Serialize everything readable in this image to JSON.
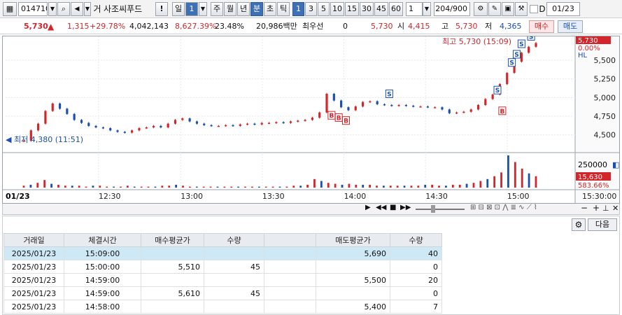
{
  "toolbar": {
    "code": "014710",
    "name": "사조씨푸드",
    "prefix": "거",
    "exclaim": "!",
    "period_day": "일",
    "period_num": "1",
    "periods": [
      "주",
      "월",
      "년",
      "분",
      "초",
      "틱"
    ],
    "periods_active": "분",
    "intervals": [
      "1",
      "3",
      "5",
      "10",
      "15",
      "30",
      "45",
      "60"
    ],
    "interval_active": "1",
    "interval_select": "1",
    "bar_count": "204/900",
    "check_label": "D",
    "date_value": "01/23"
  },
  "quote": {
    "price": "5,730",
    "change": "1,315",
    "change_pct": "+29.78%",
    "volume": "4,042,143",
    "vol_ratio": "8,627.39%",
    "turnover": "23.48%",
    "amount": "20,986백만",
    "best_label": "최우선",
    "best_value": "0",
    "ask": "5,730",
    "open_label": "시",
    "open": "4,415",
    "high_label": "고",
    "high": "5,730",
    "low_label": "저",
    "low": "4,365",
    "buy_label": "매수",
    "sell_label": "매도"
  },
  "chart_data": {
    "type": "candlestick",
    "date": "01/23",
    "x_ticks": [
      "12:30",
      "13:00",
      "13:30",
      "14:00",
      "14:30",
      "15:00",
      "15:30:00"
    ],
    "y_ticks": [
      4500,
      4750,
      5000,
      5250,
      5500
    ],
    "ylim": [
      4300,
      5800
    ],
    "high_annotation": "최고 5,730 (15:09)",
    "low_annotation": "최저 4,380 (11:51)",
    "price_tag": "5,730",
    "pct_tag": "0.00%",
    "hi_tag": "HL",
    "volume_ticks": [
      250000
    ],
    "volume_tag": "15,630",
    "volume_pct_tag": "583.66%",
    "price_path": [
      [
        0,
        4420
      ],
      [
        3,
        4560
      ],
      [
        6,
        4650
      ],
      [
        9,
        4820
      ],
      [
        12,
        4920
      ],
      [
        15,
        4850
      ],
      [
        18,
        4780
      ],
      [
        21,
        4700
      ],
      [
        24,
        4660
      ],
      [
        27,
        4620
      ],
      [
        30,
        4600
      ],
      [
        33,
        4590
      ],
      [
        36,
        4560
      ],
      [
        39,
        4540
      ],
      [
        42,
        4530
      ],
      [
        45,
        4560
      ],
      [
        48,
        4590
      ],
      [
        51,
        4600
      ],
      [
        54,
        4620
      ],
      [
        57,
        4600
      ],
      [
        60,
        4650
      ],
      [
        63,
        4700
      ],
      [
        66,
        4720
      ],
      [
        69,
        4680
      ],
      [
        72,
        4650
      ],
      [
        75,
        4630
      ],
      [
        78,
        4620
      ],
      [
        81,
        4620
      ],
      [
        84,
        4630
      ],
      [
        87,
        4620
      ],
      [
        90,
        4640
      ],
      [
        93,
        4650
      ],
      [
        96,
        4640
      ],
      [
        99,
        4660
      ],
      [
        102,
        4660
      ],
      [
        105,
        4670
      ],
      [
        108,
        4660
      ],
      [
        111,
        4680
      ],
      [
        114,
        4690
      ],
      [
        117,
        4700
      ],
      [
        120,
        4730
      ],
      [
        123,
        4800
      ],
      [
        126,
        5050
      ],
      [
        129,
        4960
      ],
      [
        132,
        4870
      ],
      [
        135,
        4830
      ],
      [
        138,
        4880
      ],
      [
        141,
        4940
      ],
      [
        144,
        4950
      ],
      [
        147,
        4910
      ],
      [
        150,
        4900
      ],
      [
        153,
        4890
      ],
      [
        156,
        4900
      ],
      [
        159,
        4890
      ],
      [
        162,
        4880
      ],
      [
        165,
        4880
      ],
      [
        168,
        4870
      ],
      [
        171,
        4870
      ],
      [
        174,
        4840
      ],
      [
        177,
        4790
      ],
      [
        180,
        4800
      ],
      [
        183,
        4810
      ],
      [
        186,
        4840
      ],
      [
        189,
        4900
      ],
      [
        192,
        4980
      ],
      [
        195,
        5040
      ],
      [
        198,
        5180
      ],
      [
        201,
        5330
      ],
      [
        204,
        5480
      ],
      [
        207,
        5600
      ],
      [
        210,
        5680
      ],
      [
        213,
        5730
      ]
    ],
    "volumes": [
      2,
      3,
      5,
      8,
      4,
      3,
      2,
      2,
      2,
      1,
      2,
      2,
      1,
      1,
      1,
      2,
      1,
      1,
      1,
      1,
      2,
      2,
      3,
      2,
      1,
      1,
      1,
      1,
      1,
      1,
      1,
      1,
      1,
      1,
      1,
      1,
      1,
      1,
      1,
      2,
      2,
      3,
      9,
      7,
      5,
      4,
      3,
      4,
      3,
      3,
      3,
      2,
      2,
      2,
      2,
      2,
      2,
      2,
      3,
      3,
      2,
      2,
      3,
      3,
      4,
      5,
      7,
      9,
      12,
      16,
      34,
      27,
      20,
      15,
      12
    ],
    "buy_marks": [
      "B",
      "B",
      "B",
      "B"
    ],
    "sell_marks": [
      "S",
      "S",
      "S",
      "S",
      "S",
      "S"
    ]
  },
  "colors": {
    "up": "#d3262b",
    "down": "#1b4fb0",
    "accent": "#3f6fb5"
  },
  "panel": {
    "next_label": "다음",
    "headers": [
      "거래일",
      "체결시간",
      "매수평균가",
      "수량",
      "",
      "매도평균가",
      "수량"
    ],
    "rows": [
      {
        "date": "2025/01/23",
        "time": "15:09:00",
        "buy_avg": "",
        "buy_qty": "",
        "blank": "",
        "sell_avg": "5,690",
        "sell_qty": "40"
      },
      {
        "date": "2025/01/23",
        "time": "15:00:00",
        "buy_avg": "5,510",
        "buy_qty": "45",
        "blank": "",
        "sell_avg": "",
        "sell_qty": "0"
      },
      {
        "date": "2025/01/23",
        "time": "14:59:00",
        "buy_avg": "",
        "buy_qty": "",
        "blank": "",
        "sell_avg": "5,500",
        "sell_qty": "20"
      },
      {
        "date": "2025/01/23",
        "time": "14:59:00",
        "buy_avg": "5,610",
        "buy_qty": "45",
        "blank": "",
        "sell_avg": "",
        "sell_qty": "0"
      },
      {
        "date": "2025/01/23",
        "time": "14:58:00",
        "buy_avg": "",
        "buy_qty": "",
        "blank": "",
        "sell_avg": "5,400",
        "sell_qty": "7"
      }
    ]
  }
}
